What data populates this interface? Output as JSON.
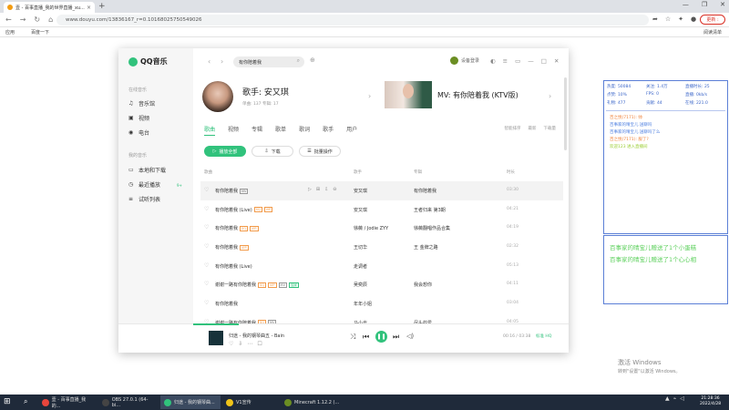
{
  "browser": {
    "tab_title": "壹 - 百事直播_我的世界直播_xu...",
    "tab_close": "×",
    "new_tab": "+",
    "url": "www.douyu.com/13836167_r=0.10168025750549026",
    "bookmarks": {
      "apps": "应用",
      "baidu": "百度一下",
      "reading_list": "阅读清单"
    },
    "update_label": "更新 :"
  },
  "qqmusic": {
    "logo": "QQ音乐",
    "sidebar": {
      "section_online": "在线音乐",
      "items_online": [
        {
          "label": "音乐馆",
          "icon": "♫"
        },
        {
          "label": "视频",
          "icon": "▣"
        },
        {
          "label": "电台",
          "icon": "◉"
        }
      ],
      "section_mine": "我的音乐",
      "items_mine": [
        {
          "label": "本地和下载",
          "icon": "▭"
        },
        {
          "label": "最近播放",
          "icon": "◷"
        },
        {
          "label": "试听列表",
          "icon": "≡"
        }
      ],
      "like_tag": "9+"
    },
    "search": {
      "value": "有你陪着我"
    },
    "user_label": "设备登录",
    "artist": {
      "name": "歌手: 安又琪",
      "stats": "单曲: 137    专辑: 17"
    },
    "mv": {
      "title": "MV: 有你陪着我 (KTV版)"
    },
    "tabs": [
      "歌曲",
      "视频",
      "专辑",
      "歌单",
      "歌词",
      "歌手",
      "用户"
    ],
    "tab_right": [
      "智能排序",
      "最新",
      "下载量"
    ],
    "buttons": {
      "play_all": "播放全部",
      "download": "下载",
      "batch": "批量操作"
    },
    "columns": {
      "title": "歌曲",
      "artist": "歌手",
      "album": "专辑",
      "duration": "时长"
    },
    "rows": [
      {
        "title": "有你陪着我",
        "tags": [
          "MV"
        ],
        "artist": "安又琪",
        "album": "有你陪着我",
        "duration": "03:30"
      },
      {
        "title": "有你陪着我 (Live)",
        "tags": [
          "SQ",
          "VIP"
        ],
        "artist": "安又琪",
        "album": "王者归来 第3期",
        "duration": "04:21"
      },
      {
        "title": "有你陪着我",
        "tags": [
          "SQ",
          "VIP"
        ],
        "artist": "徐薇 / Jodie ZYY",
        "album": "徐薇翻唱作品合集",
        "duration": "04:19"
      },
      {
        "title": "有你陪着我",
        "tags": [
          "VIP"
        ],
        "artist": "王切华",
        "album": "王 金牌之路",
        "duration": "02:32"
      },
      {
        "title": "有你陪着我 (Live)",
        "tags": [],
        "artist": "走调者",
        "album": "",
        "duration": "05:13"
      },
      {
        "title": "谢谢一路有你陪着我",
        "tags": [
          "SQ",
          "VIP",
          "MV",
          "独家"
        ],
        "artist": "吴奕辰",
        "album": "我会想你",
        "duration": "04:11"
      },
      {
        "title": "有你陪着我",
        "tags": [],
        "artist": "年年小姐",
        "album": "",
        "duration": "03:04"
      },
      {
        "title": "谢谢一路有你陪着我",
        "tags": [
          "SQ",
          "MV"
        ],
        "artist": "马小光",
        "album": "尽头的爱",
        "duration": "04:05"
      }
    ],
    "player": {
      "now_playing": "归途 - 我的钢琴曲五 - Bain",
      "time": "00:16 / 03:38",
      "quality": "标准 HQ"
    }
  },
  "danmu": {
    "stats": [
      {
        "label": "热度: 50084",
        "row": 0,
        "col": 0
      },
      {
        "label": "关注: 1.4万",
        "row": 0,
        "col": 1
      },
      {
        "label": "直播时长: 25",
        "row": 0,
        "col": 2
      },
      {
        "label": "点赞: 10%",
        "row": 1,
        "col": 0
      },
      {
        "label": "FPS: 0",
        "row": 1,
        "col": 1
      },
      {
        "label": "直播: 0kb/s",
        "row": 1,
        "col": 2
      },
      {
        "label": "礼物: 477",
        "row": 2,
        "col": 0
      },
      {
        "label": "贡献: 44",
        "row": 2,
        "col": 1
      },
      {
        "label": "在线: 221.0",
        "row": 2,
        "col": 2
      }
    ],
    "messages": [
      {
        "text": "百之悦(7171): 帅",
        "color": "#f0843c"
      },
      {
        "text": "百事家的晴宝儿 送聊吗",
        "color": "#4f80e0"
      },
      {
        "text": "百事家的晴宝儿 送聊吗了么",
        "color": "#4f80e0"
      },
      {
        "text": "百之悦(7171): 服了?",
        "color": "#f0843c"
      },
      {
        "text": "欢迎123 进入直播间",
        "color": "#9acd32"
      }
    ],
    "gifts": [
      "百事家的晴宝儿赠送了1个小蛋糕",
      "百事家的晴宝儿赠送了1个心心相"
    ]
  },
  "windows": {
    "activate_title": "激活 Windows",
    "activate_sub": "转到\"设置\"以激活 Windows。",
    "taskbar_items": [
      {
        "label": "壹 - 百事直播_我的...",
        "color": "#e8453c"
      },
      {
        "label": "OBS 27.0.1 (64-bi...",
        "color": "#444"
      },
      {
        "label": "归途 - 我的钢琴曲...",
        "color": "#31c27c"
      },
      {
        "label": "V1宣传",
        "color": "#f0c419"
      },
      {
        "label": "Minecraft 1.12.2 (...",
        "color": "#6b8e23"
      }
    ],
    "time": "21:28:36",
    "date": "2022/4/28"
  }
}
